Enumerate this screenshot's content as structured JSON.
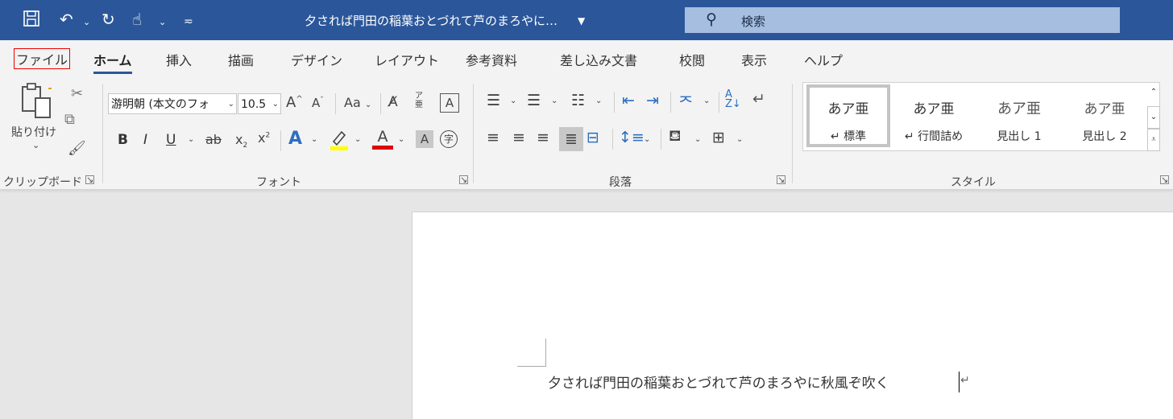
{
  "title_bar": {
    "save_icon": "save-icon",
    "undo_icon": "undo-icon",
    "redo_icon": "redo-icon",
    "touch_icon": "touch-mode-icon",
    "document_title": "夕されば門田の稲葉おとづれて芦のまろやに…",
    "search_placeholder": "検索",
    "accent_color": "#2b579a"
  },
  "tabs": [
    "ファイル",
    "ホーム",
    "挿入",
    "描画",
    "デザイン",
    "レイアウト",
    "参考資料",
    "差し込み文書",
    "校閲",
    "表示",
    "ヘルプ"
  ],
  "active_tab": "ホーム",
  "clipboard": {
    "paste_label": "貼り付け",
    "group_label": "クリップボード"
  },
  "font": {
    "font_name": "游明朝 (本文のフォ",
    "font_size": "10.5",
    "grow_label": "A",
    "shrink_label": "A",
    "case_label": "Aa",
    "bold": "B",
    "italic": "I",
    "underline": "U",
    "strike": "ab",
    "subscript": "x",
    "superscript": "x",
    "text_effects": "A",
    "font_color": "A",
    "char_shade": "A",
    "enclose_char": "字",
    "border_char": "A",
    "group_label": "フォント"
  },
  "paragraph": {
    "group_label": "段落"
  },
  "styles": {
    "items": [
      {
        "sample": "あア亜",
        "name": "↵ 標準"
      },
      {
        "sample": "あア亜",
        "name": "↵ 行間詰め"
      },
      {
        "sample": "あア亜",
        "name": "見出し 1"
      },
      {
        "sample": "あア亜",
        "name": "見出し 2"
      }
    ],
    "group_label": "スタイル"
  },
  "document": {
    "text": "夕されば門田の稲葉おとづれて芦のまろやに秋風ぞ吹く"
  }
}
